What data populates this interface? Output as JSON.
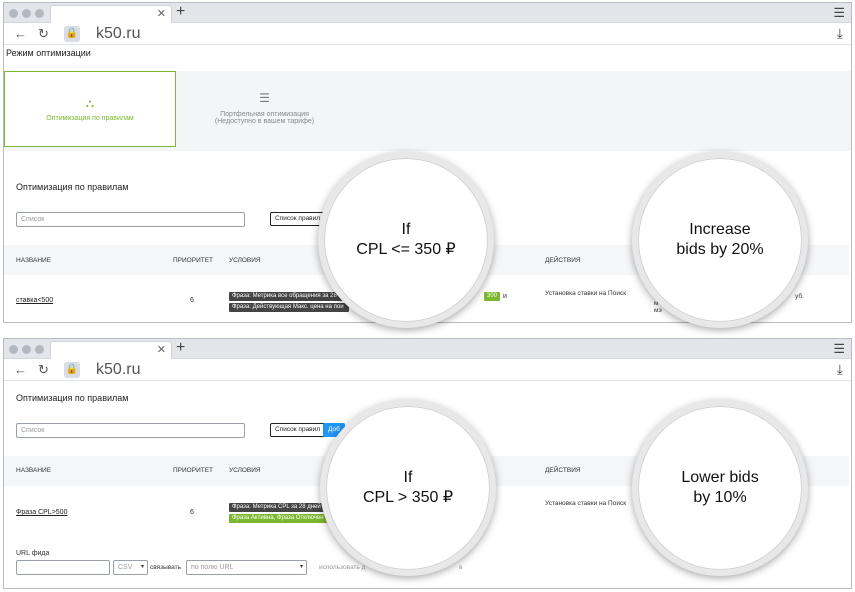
{
  "browser": {
    "domain": "k50.ru"
  },
  "top": {
    "mode_title": "Режим оптимизации",
    "card1_label": "Оптимизация по правилам",
    "card2_line1": "Портфельная оптимизация",
    "card2_line2": "(Недоступно в вашем тарифе)",
    "section_title": "Оптимизация по правилам",
    "search_placeholder": "Список",
    "list_button": "Список правил",
    "col_name": "НАЗВАНИЕ",
    "col_priority": "ПРИОРИТЕТ",
    "col_conditions": "УСЛОВИЯ",
    "col_actions": "ДЕЙСТВИЯ",
    "row_name": "ставка<500",
    "row_priority": "6",
    "tag1": "Фраза: Метрика все обращения за 28",
    "tag2": "Фраза: Действующая Макс. цена на пои",
    "value_badge": "300",
    "and_label": "и",
    "action": "Установка ставки на Поиск",
    "side_frag1": "уб.",
    "side_frag2": "м",
    "side_frag3": "мэ"
  },
  "bottom": {
    "section_title": "Оптимизация по правилам",
    "search_placeholder": "Список",
    "list_button": "Список правил",
    "add_button": "Доб",
    "col_name": "НАЗВАНИЕ",
    "col_priority": "ПРИОРИТЕТ",
    "col_conditions": "УСЛОВИЯ",
    "col_actions": "ДЕЙСТВИЯ",
    "row_name": "Фраза CPL>500",
    "row_priority": "6",
    "tag1": "Фраза: Метрика CPL за 28 дней",
    "tag2": "Фраза Активна, Фраза Отключен",
    "action": "Установка ставки на Поиск",
    "feed_label": "URL фида",
    "format_value": "CSV",
    "link_label": "связывать",
    "url_select": "по полю URL",
    "use_label": "использовать д",
    "use_tail": "в"
  },
  "callouts": {
    "c1_line1": "If",
    "c1_line2": "CPL <= 350 ₽",
    "c2_line1": "Increase",
    "c2_line2": "bids by 20%",
    "c3_line1": "If",
    "c3_line2": "CPL > 350 ₽",
    "c4_line1": "Lower bids",
    "c4_line2": "by 10%"
  },
  "colors": {
    "accent_green": "#7cb82f",
    "tag_dark": "#444444",
    "add_blue": "#2196f3"
  }
}
